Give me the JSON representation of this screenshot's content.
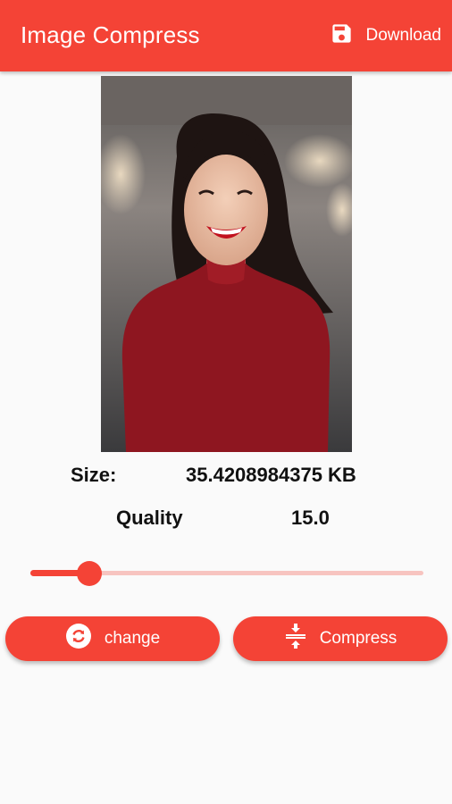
{
  "app": {
    "title": "Image Compress",
    "download_label": "Download",
    "primary_color": "#f44336"
  },
  "icons": {
    "download": "save-icon",
    "change": "refresh-icon",
    "compress": "compress-icon"
  },
  "info": {
    "size_label": "Size:",
    "size_value": "35.4208984375 KB",
    "quality_label": "Quality",
    "quality_value": "15.0"
  },
  "slider": {
    "value_fraction": 0.15
  },
  "buttons": {
    "change_label": "change",
    "compress_label": "Compress"
  }
}
